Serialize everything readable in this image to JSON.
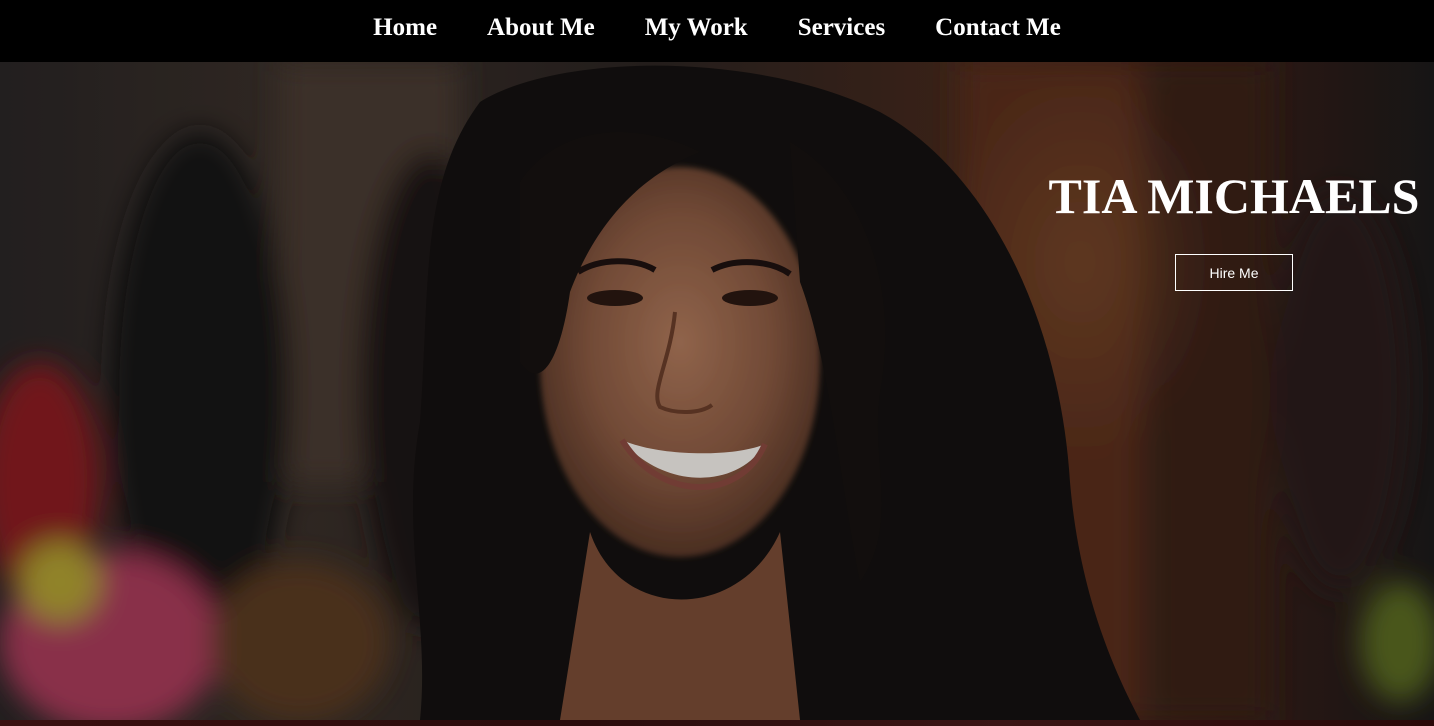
{
  "nav": {
    "items": [
      {
        "label": "Home"
      },
      {
        "label": "About Me"
      },
      {
        "label": "My Work"
      },
      {
        "label": "Services"
      },
      {
        "label": "Contact Me"
      }
    ]
  },
  "hero": {
    "name": "TIA MICHAELS",
    "cta_label": "Hire Me",
    "photo": "hero-portrait-photo"
  },
  "colors": {
    "nav_background": "#000000",
    "text": "#ffffff"
  }
}
